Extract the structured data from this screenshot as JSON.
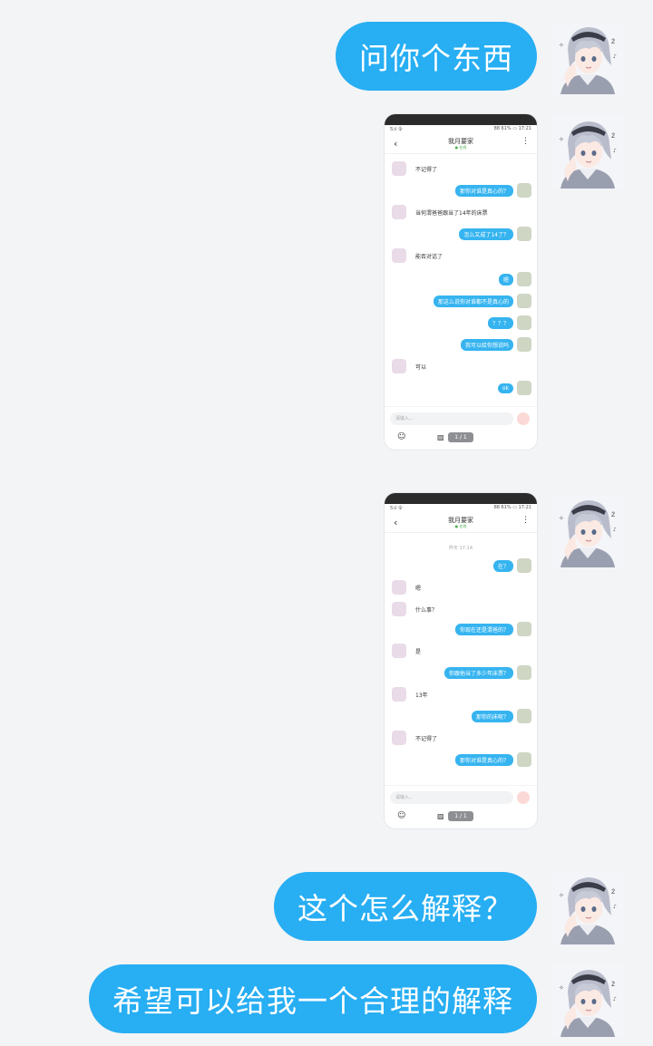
{
  "messages": [
    {
      "type": "text",
      "text": "问你个东西"
    },
    {
      "type": "image"
    },
    {
      "type": "image"
    },
    {
      "type": "text",
      "text": "这个怎么解释？"
    },
    {
      "type": "text",
      "text": "希望可以给我一个合理的解释"
    }
  ],
  "shot1": {
    "status_left": "5⫶ıl 令",
    "status_right": "88 61% ▭ 17:21",
    "contact": "我月要家",
    "online": "● 在线",
    "items": [
      {
        "dir": "in",
        "text": "不记得了"
      },
      {
        "dir": "out",
        "text": "那你对谁是真心的？"
      },
      {
        "dir": "in",
        "text": "当何渭爸爸跟当了14年的床票"
      },
      {
        "dir": "out",
        "text": "怎么又成了14了？"
      },
      {
        "dir": "in",
        "text": "能否对话了"
      },
      {
        "dir": "out",
        "text": "嗯"
      },
      {
        "dir": "out",
        "text": "那这么说你对谁都不是真心的"
      },
      {
        "dir": "out",
        "text": "？？？"
      },
      {
        "dir": "out",
        "text": "我可以给你想说吗"
      },
      {
        "dir": "in",
        "text": "可以"
      },
      {
        "dir": "out",
        "text": "ok"
      }
    ],
    "input_placeholder": "请输入...",
    "pager": "1 / 1"
  },
  "shot2": {
    "status_left": "5⫶ıl 令",
    "status_right": "88 61% ▭ 17:21",
    "contact": "我月要家",
    "online": "● 在线",
    "time": "昨天 17:14",
    "items": [
      {
        "dir": "out",
        "text": "在？"
      },
      {
        "dir": "in",
        "text": "嗯"
      },
      {
        "dir": "in",
        "text": "什么事？"
      },
      {
        "dir": "out",
        "text": "你现在还是渭爸的？"
      },
      {
        "dir": "in",
        "text": "是"
      },
      {
        "dir": "out",
        "text": "你跟他当了多少年床票？"
      },
      {
        "dir": "in",
        "text": "13年"
      },
      {
        "dir": "out",
        "text": "那你的床呢？"
      },
      {
        "dir": "in",
        "text": "不记得了"
      },
      {
        "dir": "out",
        "text": "那你对谁是真心的？"
      }
    ],
    "input_placeholder": "请输入...",
    "pager": "1 / 1"
  }
}
